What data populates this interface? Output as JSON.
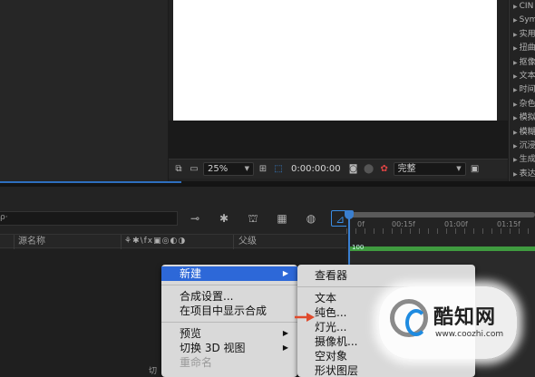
{
  "viewer": {
    "zoom": "25%",
    "timecode": "0:00:00:00",
    "resolution": "完整"
  },
  "effects_panel": {
    "items": [
      "CIN",
      "Sym",
      "实用",
      "扭曲",
      "抠像",
      "文本",
      "时间",
      "杂色",
      "模拟",
      "模糊",
      "沉浸",
      "生成",
      "表达"
    ]
  },
  "timeline": {
    "source_name_label": "源名称",
    "switches_label": "⚘✱\\fx▣◎◐◑",
    "parent_label": "父级",
    "ruler_labels": [
      "0f",
      "00:15f",
      "01:00f",
      "01:15f"
    ],
    "layer_duration_label": "100"
  },
  "context_menu": {
    "items": [
      {
        "label": "新建",
        "has_submenu": true,
        "highlighted": true
      },
      {
        "label": "合成设置...",
        "has_submenu": false
      },
      {
        "label": "在项目中显示合成",
        "has_submenu": false
      },
      {
        "label": "预览",
        "has_submenu": true
      },
      {
        "label": "切换 3D 视图",
        "has_submenu": true
      },
      {
        "label": "重命名",
        "has_submenu": false
      }
    ]
  },
  "submenu": {
    "items": [
      "查看器",
      "文本",
      "纯色...",
      "灯光...",
      "摄像机...",
      "空对象",
      "形状图层"
    ]
  },
  "bottom_tab_label": "切",
  "watermark": {
    "text": "酷知网",
    "url": "www.coozhi.com"
  },
  "colors": {
    "menu_highlight": "#2d68d8",
    "playhead": "#3a7fd0",
    "track": "#3f9b3f",
    "arrow": "#e04a2c"
  }
}
